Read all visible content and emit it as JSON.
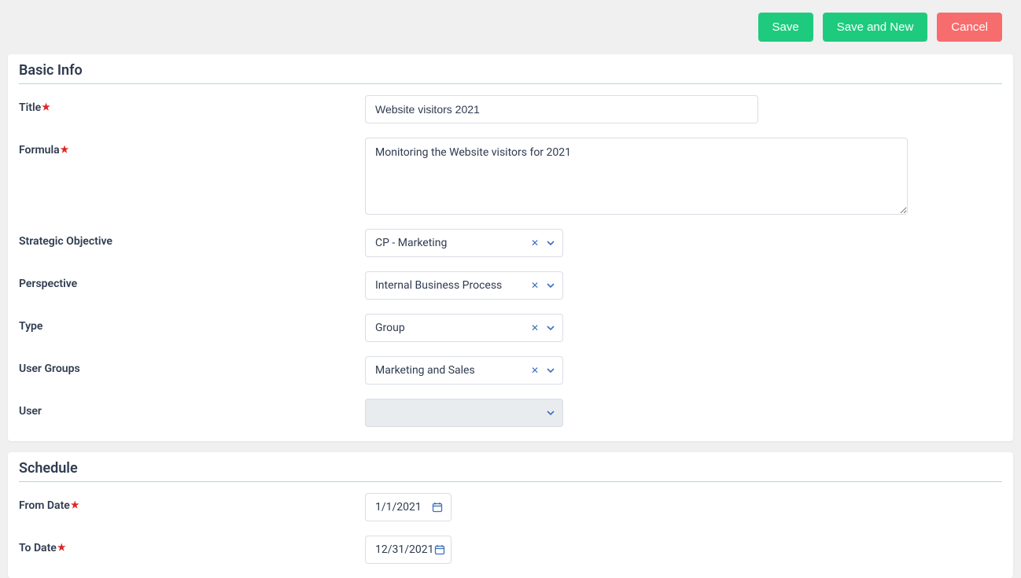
{
  "actions": {
    "save": "Save",
    "save_and_new": "Save and New",
    "cancel": "Cancel"
  },
  "basic_info": {
    "title": "Basic Info",
    "fields": {
      "title_label": "Title",
      "title_value": "Website visitors 2021",
      "formula_label": "Formula",
      "formula_value": "Monitoring the Website visitors for 2021",
      "strategic_objective_label": "Strategic Objective",
      "strategic_objective_value": "CP - Marketing",
      "perspective_label": "Perspective",
      "perspective_value": "Internal Business Process",
      "type_label": "Type",
      "type_value": "Group",
      "user_groups_label": "User Groups",
      "user_groups_value": "Marketing and Sales",
      "user_label": "User",
      "user_value": ""
    }
  },
  "schedule": {
    "title": "Schedule",
    "from_date_label": "From Date",
    "from_date_value": "1/1/2021",
    "to_date_label": "To Date",
    "to_date_value": "12/31/2021"
  }
}
